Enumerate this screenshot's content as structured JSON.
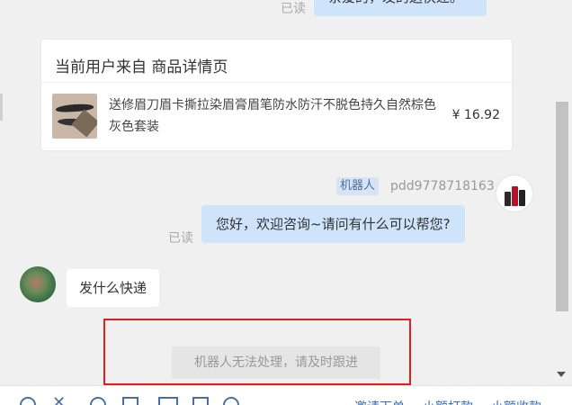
{
  "chat": {
    "msg1": {
      "read_label": "已读",
      "text": "亲爱的，发的送快递。"
    },
    "product_card": {
      "title": "当前用户来自 商品详情页",
      "product_name": "送修眉刀眉卡撕拉染眉膏眉笔防水防汗不脱色持久自然棕色灰色套装",
      "price": "¥ 16.92"
    },
    "agent": {
      "role_tag": "机器人",
      "name": "pdd9778718163"
    },
    "msg2": {
      "read_label": "已读",
      "text": "您好，欢迎咨询~请问有什么可以帮您?"
    },
    "user_msg": {
      "text": "发什么快递"
    },
    "system_notice": "机器人无法处理，请及时跟进"
  },
  "toolbar": {
    "links": [
      "邀请下单",
      "小额打款",
      "小额收款"
    ]
  },
  "colors": {
    "bubble_blue": "#cfe3fb",
    "highlight_red": "#e0201f",
    "link_blue": "#3a6fb5"
  }
}
